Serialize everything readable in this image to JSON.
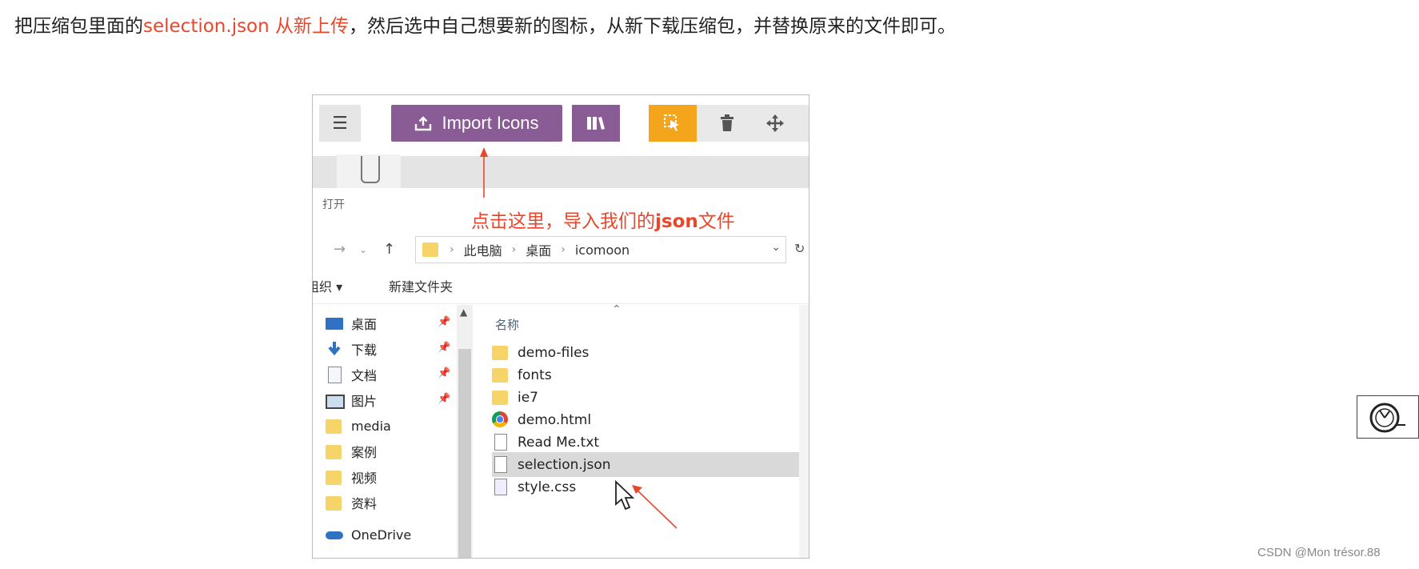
{
  "instruction": {
    "before": "把压缩包里面的",
    "highlight": "selection.json 从新上传",
    "after": "，然后选中自己想要新的图标，从新下载压缩包，并替换原来的文件即可。"
  },
  "toolbar": {
    "import_label": "Import Icons"
  },
  "annotation": {
    "text_before": "点击这里，导入我们的",
    "text_bold": "json",
    "text_after": "文件"
  },
  "dialog": {
    "title": "打开",
    "breadcrumb": [
      "此电脑",
      "桌面",
      "icomoon"
    ],
    "organize_label": "组织 ▾",
    "new_folder_label": "新建文件夹",
    "column_name": "名称",
    "nav_items": [
      {
        "label": "桌面",
        "icon": "desktop-icon",
        "pinned": true
      },
      {
        "label": "下载",
        "icon": "download-icon",
        "pinned": true
      },
      {
        "label": "文档",
        "icon": "document-icon",
        "pinned": true
      },
      {
        "label": "图片",
        "icon": "picture-icon",
        "pinned": true
      },
      {
        "label": "media",
        "icon": "folder-icon",
        "pinned": false
      },
      {
        "label": "案例",
        "icon": "folder-icon",
        "pinned": false
      },
      {
        "label": "视频",
        "icon": "folder-icon",
        "pinned": false
      },
      {
        "label": "资料",
        "icon": "folder-icon",
        "pinned": false
      },
      {
        "label": "OneDrive",
        "icon": "onedrive-icon",
        "pinned": false
      }
    ],
    "files": [
      {
        "name": "demo-files",
        "type": "folder"
      },
      {
        "name": "fonts",
        "type": "folder"
      },
      {
        "name": "ie7",
        "type": "folder"
      },
      {
        "name": "demo.html",
        "type": "chrome"
      },
      {
        "name": "Read Me.txt",
        "type": "text"
      },
      {
        "name": "selection.json",
        "type": "text",
        "selected": true
      },
      {
        "name": "style.css",
        "type": "css"
      }
    ]
  },
  "footer": {
    "credit": "CSDN @Mon trésor.88"
  },
  "colors": {
    "accent_red": "#e8472c",
    "icomoon_purple": "#8a5c96",
    "select_orange": "#f4a51c"
  }
}
